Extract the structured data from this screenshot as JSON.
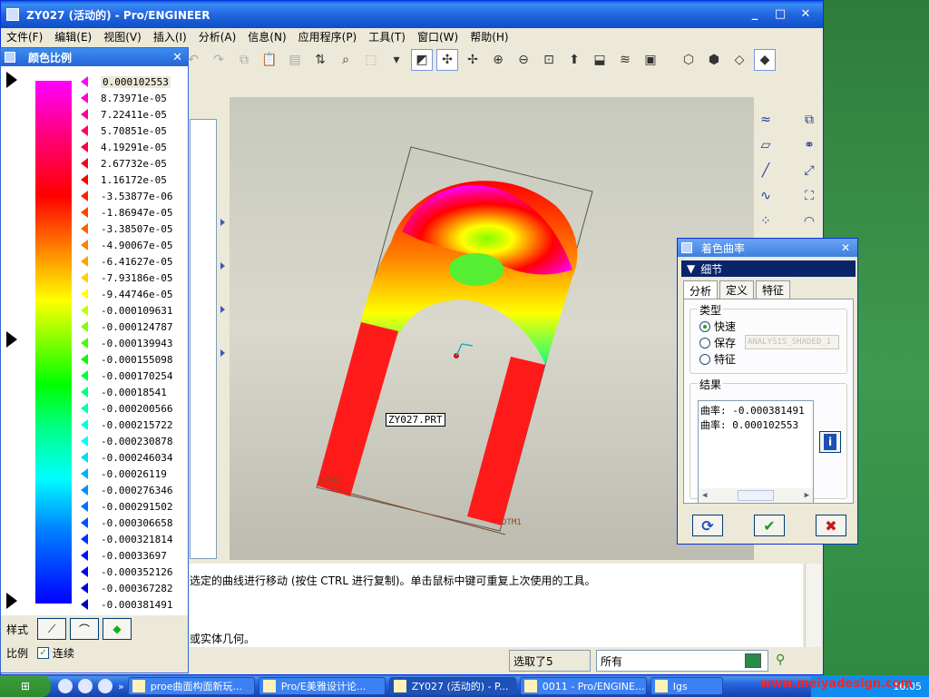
{
  "window": {
    "title": "ZY027 (活动的) - Pro/ENGINEER",
    "controls": [
      "_",
      "□",
      "✕"
    ]
  },
  "menu": [
    "文件(F)",
    "编辑(E)",
    "视图(V)",
    "插入(I)",
    "分析(A)",
    "信息(N)",
    "应用程序(P)",
    "工具(T)",
    "窗口(W)",
    "帮助(H)"
  ],
  "color_scale": {
    "title": "颜色比例",
    "close": "✕",
    "ticks": [
      {
        "label": "0.000102553",
        "color": "#ff00ff"
      },
      {
        "label": "8.73971e-05",
        "color": "#ff00cc"
      },
      {
        "label": "7.22411e-05",
        "color": "#ff0099"
      },
      {
        "label": "5.70851e-05",
        "color": "#ff0066"
      },
      {
        "label": "4.19291e-05",
        "color": "#ff0040"
      },
      {
        "label": "2.67732e-05",
        "color": "#ff0020"
      },
      {
        "label": "1.16172e-05",
        "color": "#ff0000"
      },
      {
        "label": "-3.53877e-06",
        "color": "#ff2000"
      },
      {
        "label": "-1.86947e-05",
        "color": "#ff4000"
      },
      {
        "label": "-3.38507e-05",
        "color": "#ff6000"
      },
      {
        "label": "-4.90067e-05",
        "color": "#ff8000"
      },
      {
        "label": "-6.41627e-05",
        "color": "#ffa000"
      },
      {
        "label": "-7.93186e-05",
        "color": "#ffd000"
      },
      {
        "label": "-9.44746e-05",
        "color": "#ffff00"
      },
      {
        "label": "-0.000109631",
        "color": "#c0ff00"
      },
      {
        "label": "-0.000124787",
        "color": "#80ff00"
      },
      {
        "label": "-0.000139943",
        "color": "#40ff00"
      },
      {
        "label": "-0.000155098",
        "color": "#00ff00"
      },
      {
        "label": "-0.000170254",
        "color": "#00ff40"
      },
      {
        "label": "-0.00018541",
        "color": "#00ff80"
      },
      {
        "label": "-0.000200566",
        "color": "#00ffb0"
      },
      {
        "label": "-0.000215722",
        "color": "#00ffdd"
      },
      {
        "label": "-0.000230878",
        "color": "#00ffff"
      },
      {
        "label": "-0.000246034",
        "color": "#00ddff"
      },
      {
        "label": "-0.00026119",
        "color": "#00b0ff"
      },
      {
        "label": "-0.000276346",
        "color": "#0090ff"
      },
      {
        "label": "-0.000291502",
        "color": "#0070ff"
      },
      {
        "label": "-0.000306658",
        "color": "#0050ff"
      },
      {
        "label": "-0.000321814",
        "color": "#0030ff"
      },
      {
        "label": "-0.00033697",
        "color": "#0010ff"
      },
      {
        "label": "-0.000352126",
        "color": "#0000ff"
      },
      {
        "label": "-0.000367282",
        "color": "#0000e0"
      },
      {
        "label": "-0.000381491",
        "color": "#0000c0"
      }
    ],
    "style_label": "样式",
    "ratio_label": "比例",
    "continuous_label": "连续"
  },
  "viewport": {
    "part_label": "ZY027.PRT",
    "datum1": "DTM1",
    "datum2": "DTM2"
  },
  "messages": {
    "line1": "选定的曲线进行移动 (按住 CTRL 进行复制)。单击鼠标中键可重复上次使用的工具。",
    "line2": "或实体几何。"
  },
  "status": {
    "selected": "选取了5",
    "filter": "所有"
  },
  "dialog": {
    "title": "着色曲率",
    "close": "✕",
    "detail": "细节",
    "tabs": [
      "分析",
      "定义",
      "特征"
    ],
    "type_label": "类型",
    "options": [
      "快速",
      "保存",
      "特征"
    ],
    "save_placeholder": "ANALYSIS_SHADED_1",
    "result_label": "结果",
    "result_lines": [
      "曲率: -0.000381491",
      "曲率: 0.000102553"
    ]
  },
  "taskbar": {
    "tasks": [
      "proe曲面构面新玩...",
      "Pro/E美雅设计论...",
      "ZY027 (活动的) - P...",
      "0011 - Pro/ENGINE...",
      "Igs"
    ],
    "clock": "16:05",
    "watermark": "www.meiyadesign.com"
  }
}
